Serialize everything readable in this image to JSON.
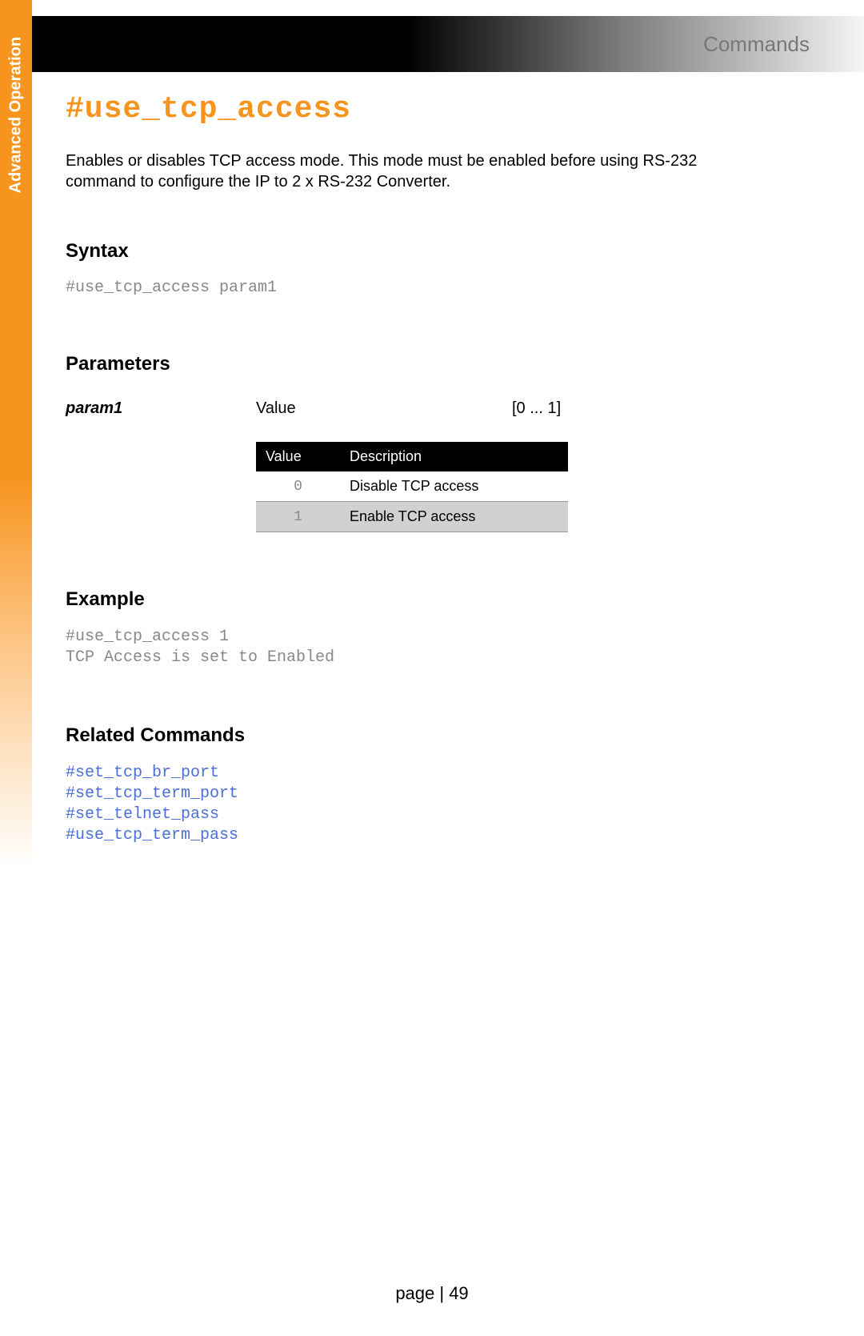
{
  "sidebar": {
    "label": "Advanced Operation"
  },
  "header": {
    "title": "Commands"
  },
  "command": {
    "title": "#use_tcp_access",
    "description": "Enables or disables TCP access mode. This mode must be enabled before using RS-232 command to configure the IP to 2 x RS-232 Converter."
  },
  "syntax": {
    "heading": "Syntax",
    "code": "#use_tcp_access param1"
  },
  "parameters": {
    "heading": "Parameters",
    "items": [
      {
        "name": "param1",
        "type": "Value",
        "range": "[0 ... 1]"
      }
    ],
    "table": {
      "headers": {
        "col1": "Value",
        "col2": "Description"
      },
      "rows": [
        {
          "value": "0",
          "description": "Disable TCP access"
        },
        {
          "value": "1",
          "description": "Enable TCP access"
        }
      ]
    }
  },
  "example": {
    "heading": "Example",
    "code": "#use_tcp_access 1\nTCP Access is set to Enabled"
  },
  "related": {
    "heading": "Related Commands",
    "commands": [
      "#set_tcp_br_port",
      "#set_tcp_term_port",
      "#set_telnet_pass",
      "#use_tcp_term_pass"
    ]
  },
  "footer": {
    "text": "page | 49"
  }
}
